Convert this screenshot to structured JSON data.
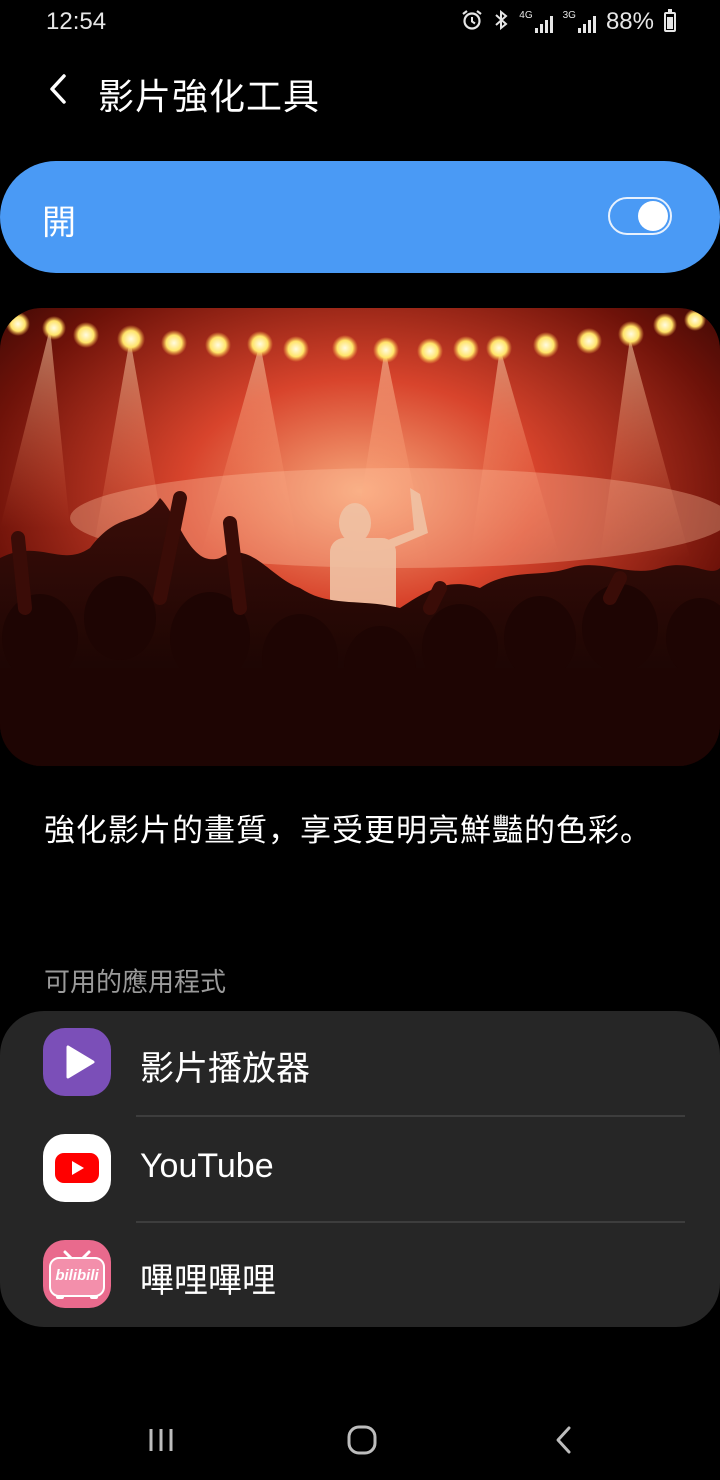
{
  "status_bar": {
    "time": "12:54",
    "network_1": "4G",
    "network_2": "3G",
    "battery": "88%",
    "icons": [
      "alarm-icon",
      "bluetooth-icon",
      "signal-icon",
      "battery-icon"
    ]
  },
  "header": {
    "title": "影片強化工具",
    "back_icon": "chevron-left-icon"
  },
  "master_switch": {
    "label": "開",
    "state": "on",
    "color": "#4a9af5"
  },
  "hero_image": {
    "subject": "concert-photo"
  },
  "description": "強化影片的畫質，享受更明亮鮮豔的色彩。",
  "apps_section": {
    "title": "可用的應用程式",
    "items": [
      {
        "name": "影片播放器",
        "icon": "video-player-icon",
        "color": "#7b4fb8"
      },
      {
        "name": "YouTube",
        "icon": "youtube-icon",
        "color": "#ff0000"
      },
      {
        "name": "嗶哩嗶哩",
        "icon": "bilibili-icon",
        "icon_text": "bilibili",
        "color": "#e96a8d"
      }
    ]
  },
  "nav_bar": {
    "buttons": [
      "recent-apps",
      "home",
      "back"
    ]
  }
}
